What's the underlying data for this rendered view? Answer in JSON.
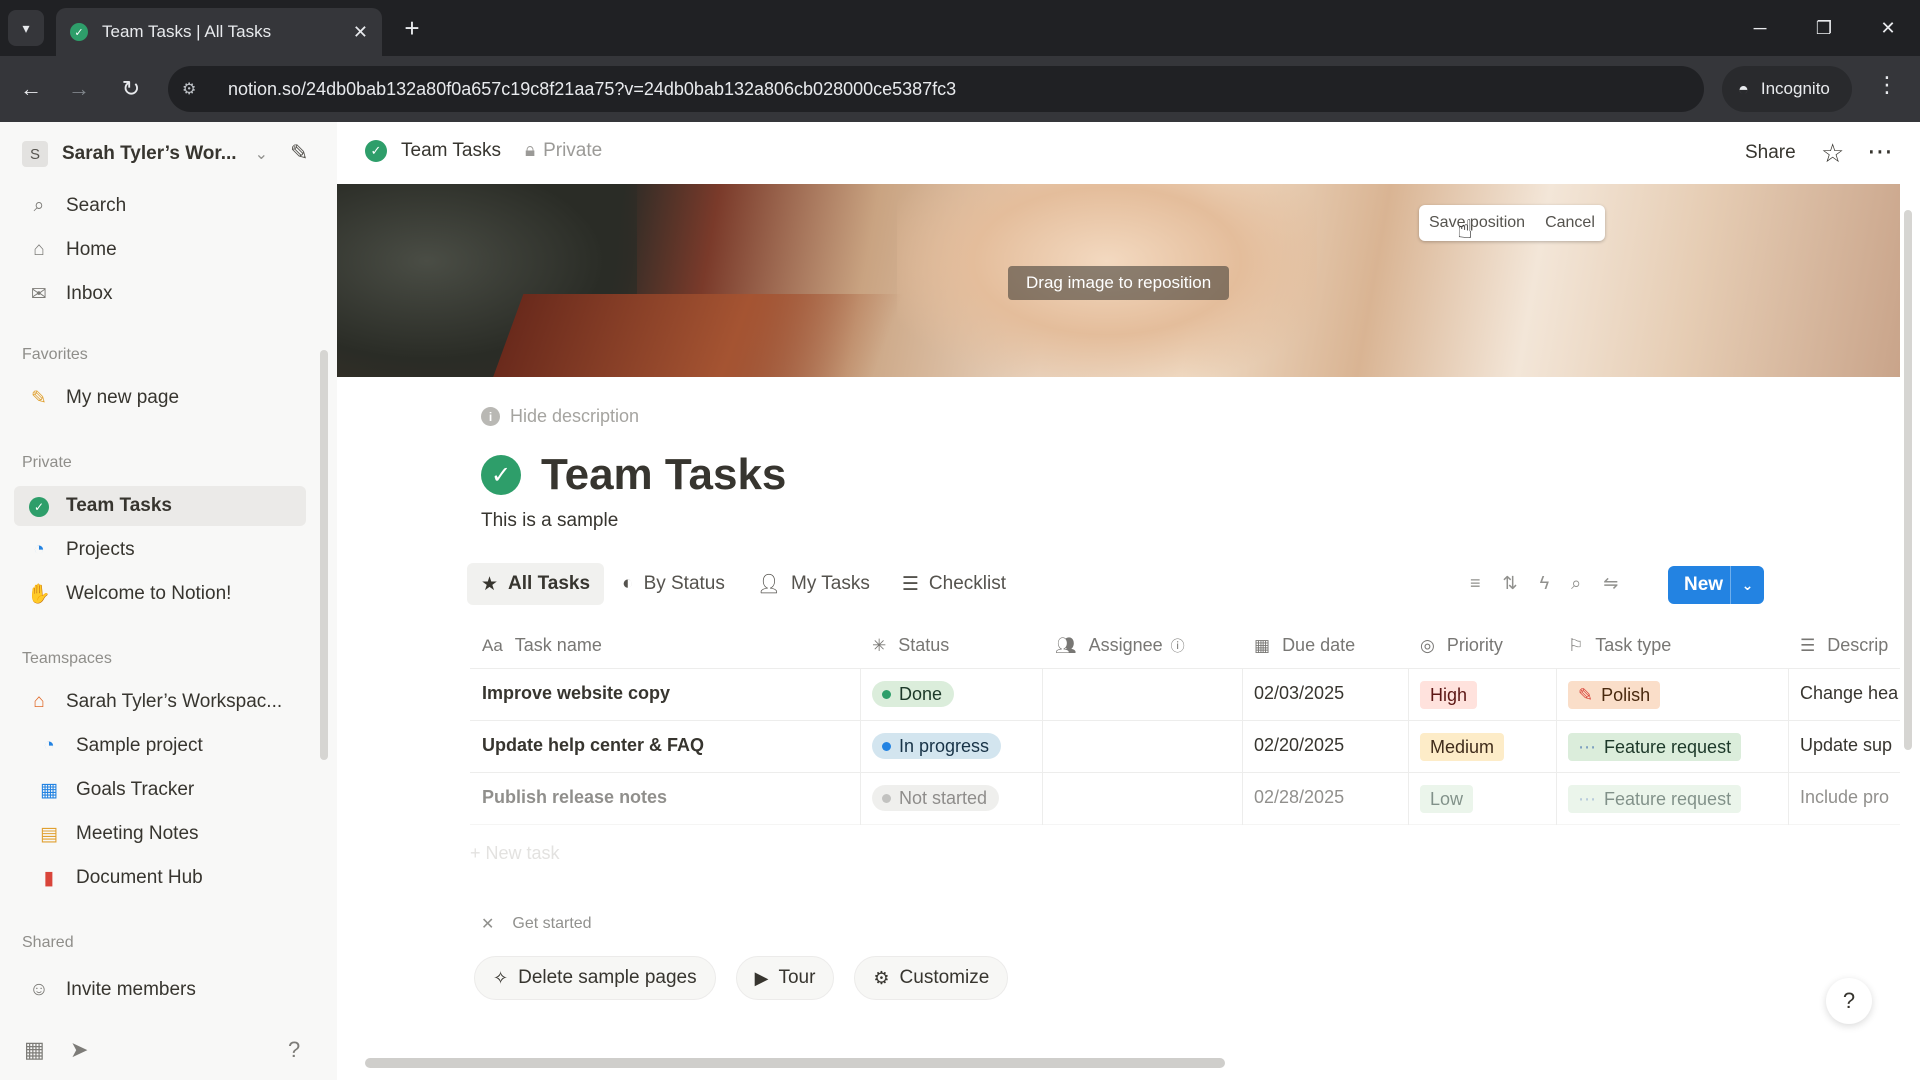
{
  "browser": {
    "tab_title": "Team Tasks | All Tasks",
    "url": "notion.so/24db0bab132a80f0a657c19c8f21aa75?v=24db0bab132a806cb028000ce5387fc3",
    "incognito_label": "Incognito"
  },
  "sidebar": {
    "workspace_initial": "S",
    "workspace_name": "Sarah Tyler’s Wor...",
    "top_items": [
      {
        "label": "Search",
        "icon": "search-icon"
      },
      {
        "label": "Home",
        "icon": "home-icon"
      },
      {
        "label": "Inbox",
        "icon": "inbox-icon"
      }
    ],
    "favorites_heading": "Favorites",
    "favorites": [
      {
        "label": "My new page",
        "icon": "pencil-icon"
      }
    ],
    "private_heading": "Private",
    "private": [
      {
        "label": "Team Tasks",
        "icon": "check-circle-icon"
      },
      {
        "label": "Projects",
        "icon": "projects-icon"
      },
      {
        "label": "Welcome to Notion!",
        "icon": "wave-icon"
      }
    ],
    "teamspaces_heading": "Teamspaces",
    "teamspace_name": "Sarah Tyler’s Workspac...",
    "teamspace_items": [
      {
        "label": "Sample project",
        "icon": "projects-icon"
      },
      {
        "label": "Goals Tracker",
        "icon": "chart-icon"
      },
      {
        "label": "Meeting Notes",
        "icon": "calendar-icon"
      },
      {
        "label": "Document Hub",
        "icon": "book-icon"
      }
    ],
    "shared_heading": "Shared",
    "invite_label": "Invite members"
  },
  "topbar": {
    "page_name": "Team Tasks",
    "privacy": "Private",
    "share_label": "Share"
  },
  "cover": {
    "save_label": "Save position",
    "cancel_label": "Cancel",
    "drag_message": "Drag image to reposition"
  },
  "page": {
    "hide_description": "Hide description",
    "title": "Team Tasks",
    "description": "This is a sample"
  },
  "views": {
    "tabs": [
      "All Tasks",
      "By Status",
      "My Tasks",
      "Checklist"
    ],
    "new_label": "New"
  },
  "table": {
    "columns": [
      "Task name",
      "Status",
      "Assignee",
      "Due date",
      "Priority",
      "Task type",
      "Descrip"
    ],
    "rows": [
      {
        "name": "Improve website copy",
        "status": "Done",
        "due": "02/03/2025",
        "priority": "High",
        "type": "Polish",
        "desc": "Change hea"
      },
      {
        "name": "Update help center & FAQ",
        "status": "In progress",
        "due": "02/20/2025",
        "priority": "Medium",
        "type": "Feature request",
        "desc": "Update sup"
      },
      {
        "name": "Publish release notes",
        "status": "Not started",
        "due": "02/28/2025",
        "priority": "Low",
        "type": "Feature request",
        "desc": "Include pro"
      }
    ],
    "new_row_label": "New task"
  },
  "get_started": {
    "label": "Get started",
    "buttons": [
      "Delete sample pages",
      "Tour",
      "Customize"
    ]
  },
  "colors": {
    "accent": "#2383e2",
    "done": "#2e9e6a",
    "high_bg": "#ffe2dd",
    "medium_bg": "#fdecc8",
    "type_bg": "#dbeddb"
  }
}
